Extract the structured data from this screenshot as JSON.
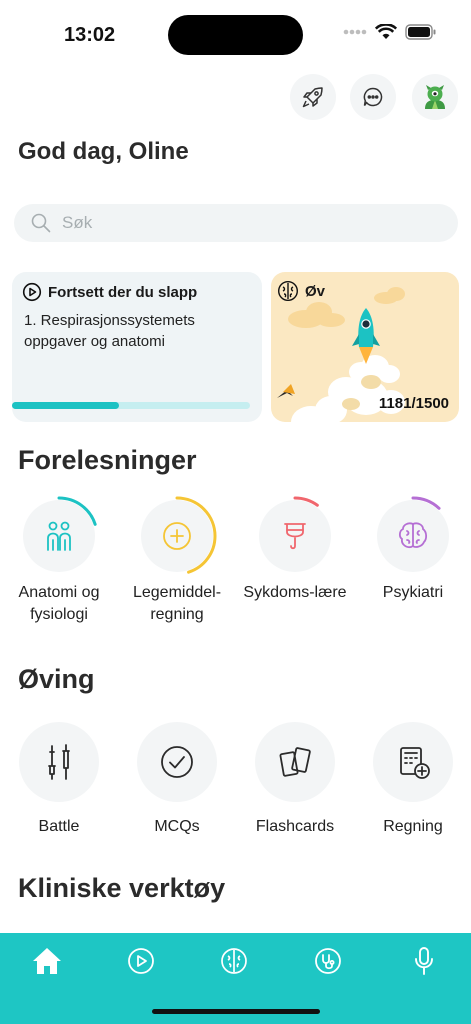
{
  "status": {
    "time": "13:02"
  },
  "greeting": "God dag, Oline",
  "search": {
    "placeholder": "Søk"
  },
  "continue_card": {
    "title": "Fortsett der du slapp",
    "subtitle": "1. Respirasjonssystemets oppgaver og anatomi",
    "progress": 0.45
  },
  "practice_card": {
    "title": "Øv",
    "count": "1181/1500"
  },
  "sections": {
    "lectures": "Forelesninger",
    "practice": "Øving",
    "clinical": "Kliniske verktøy"
  },
  "courses": [
    {
      "label": "Anatomi og fysiologi",
      "icon": "people-icon",
      "color": "#1cc2c3",
      "progress": 0.2
    },
    {
      "label": "Legemiddel-regning",
      "icon": "plus-circle-icon",
      "color": "#f5c535",
      "progress": 0.45
    },
    {
      "label": "Sykdoms-lære",
      "icon": "cup-icon",
      "color": "#f0666d",
      "progress": 0.1
    },
    {
      "label": "Psykiatri",
      "icon": "brain-icon",
      "color": "#b56fd4",
      "progress": 0.12
    }
  ],
  "practice_items": [
    {
      "label": "Battle",
      "icon": "battle-icon"
    },
    {
      "label": "MCQs",
      "icon": "check-circle-icon"
    },
    {
      "label": "Flashcards",
      "icon": "cards-icon"
    },
    {
      "label": "Regning",
      "icon": "calculator-icon"
    }
  ],
  "tabs": [
    "home-icon",
    "play-icon",
    "brain-icon",
    "stethoscope-icon",
    "microphone-icon"
  ],
  "colors": {
    "accent": "#1ec6c4",
    "practice_bg": "#fbe8c2"
  }
}
